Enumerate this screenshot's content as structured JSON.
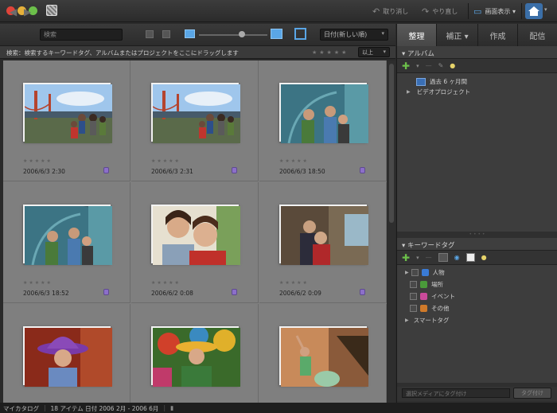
{
  "window": {
    "app_icon": "photo-organizer-app-icon"
  },
  "titlebar": {
    "undo_label": "取り消し",
    "redo_label": "やり直し",
    "view_label": "画面表示 ▾",
    "home_icon": "home-icon"
  },
  "toolbar": {
    "search_placeholder": "検索",
    "sort_label": "日付(新しい順)"
  },
  "tabs": [
    {
      "label": "整理"
    },
    {
      "label": "補正 ▾"
    },
    {
      "label": "作成"
    },
    {
      "label": "配信"
    }
  ],
  "hint": {
    "text": "検索：検索するキーワードタグ、アルバムまたはプロジェクトをここにドラッグします",
    "from_label": "以上"
  },
  "photos": [
    {
      "date": "2006/6/3 2:30",
      "scene": "bridge"
    },
    {
      "date": "2006/6/3 2:31",
      "scene": "bridge"
    },
    {
      "date": "2006/6/3 18:50",
      "scene": "aquarium"
    },
    {
      "date": "2006/6/3 18:52",
      "scene": "aquarium"
    },
    {
      "date": "2006/6/2 0:08",
      "scene": "kids"
    },
    {
      "date": "2006/6/2 0:09",
      "scene": "museum"
    },
    {
      "date": "",
      "scene": "hat"
    },
    {
      "date": "",
      "scene": "carnival"
    },
    {
      "date": "",
      "scene": "dance"
    }
  ],
  "album_panel": {
    "title": "アルバム",
    "items": [
      {
        "label": "過去 6 ヶ月間"
      },
      {
        "label": "ビデオプロジェクト"
      }
    ]
  },
  "tag_panel": {
    "title": "キーワードタグ",
    "items": [
      {
        "label": "人物",
        "color": "#3a7bd5"
      },
      {
        "label": "場所",
        "color": "#4a9a3a"
      },
      {
        "label": "イベント",
        "color": "#c94a9a"
      },
      {
        "label": "その他",
        "color": "#d07a2a"
      }
    ],
    "smart_tags": "スマートタグ",
    "tag_input_placeholder": "選択メディアにタグ付け",
    "tag_button": "タグ付け"
  },
  "status": {
    "catalog": "マイカタログ",
    "summary": "18 アイテム 日付 2006 2月 - 2006 6月"
  }
}
